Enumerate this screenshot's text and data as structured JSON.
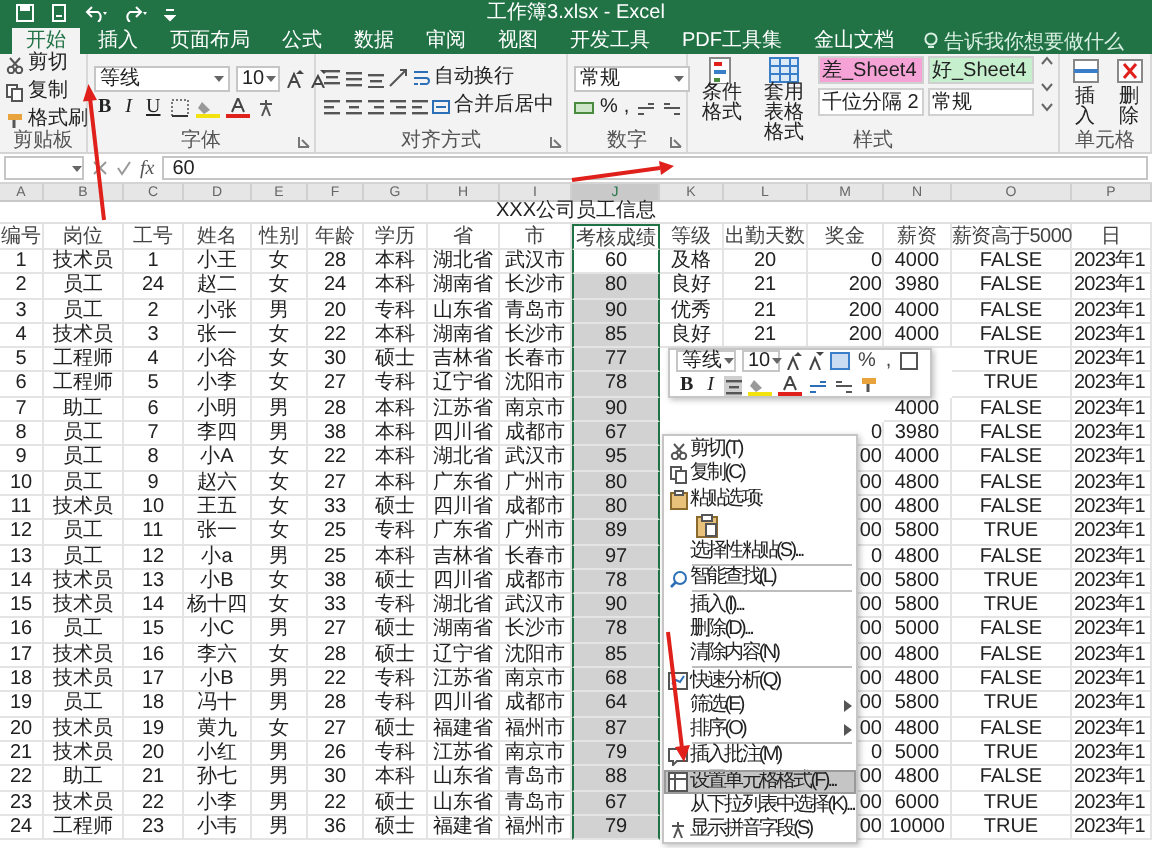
{
  "window": {
    "title": "工作簿3.xlsx - Excel"
  },
  "tabs": [
    {
      "label": "开始",
      "selected": true
    },
    {
      "label": "插入",
      "selected": false
    },
    {
      "label": "页面布局",
      "selected": false
    },
    {
      "label": "公式",
      "selected": false
    },
    {
      "label": "数据",
      "selected": false
    },
    {
      "label": "审阅",
      "selected": false
    },
    {
      "label": "视图",
      "selected": false
    },
    {
      "label": "开发工具",
      "selected": false
    },
    {
      "label": "PDF工具集",
      "selected": false
    },
    {
      "label": "金山文档",
      "selected": false
    }
  ],
  "search": {
    "placeholder": "告诉我你想要做什么"
  },
  "ribbon": [
    {
      "kind": "clipboard",
      "label": "剪贴板",
      "launcher": false,
      "items": [
        "剪切",
        "复制",
        "格式刷"
      ]
    },
    {
      "kind": "font",
      "label": "字体",
      "launcher": true,
      "font": "等线",
      "size": "10",
      "style_buttons": [
        "B",
        "I",
        "U"
      ]
    },
    {
      "kind": "align",
      "label": "对齐方式",
      "launcher": true,
      "items": [
        "自动换行",
        "合并后居中"
      ]
    },
    {
      "kind": "number",
      "label": "数字",
      "launcher": true,
      "format": "常规",
      "symbols": [
        "%",
        ","
      ]
    },
    {
      "kind": "styles",
      "label": "样式",
      "launcher": false,
      "items": [
        "条件格式",
        "套用表格格式"
      ],
      "cell_styles": [
        {
          "text": "差_Sheet4",
          "color": "#f5a3d6"
        },
        {
          "text": "好_Sheet4",
          "color": "#c6efce"
        },
        {
          "text": "千位分隔 2",
          "color": "#ffffff"
        },
        {
          "text": "常规",
          "color": "#ffffff"
        }
      ]
    },
    {
      "kind": "cells",
      "label": "单元格",
      "launcher": false,
      "items": [
        "插入",
        "删除"
      ]
    }
  ],
  "formula_bar": {
    "fx": "fx",
    "value": "60"
  },
  "sheet": {
    "title": "XXX公司员工信息",
    "columns": [
      {
        "letter": "A",
        "label": "编号",
        "selected": false
      },
      {
        "letter": "B",
        "label": "岗位",
        "selected": false
      },
      {
        "letter": "C",
        "label": "工号",
        "selected": false
      },
      {
        "letter": "D",
        "label": "姓名",
        "selected": false
      },
      {
        "letter": "E",
        "label": "性别",
        "selected": false
      },
      {
        "letter": "F",
        "label": "年龄",
        "selected": false
      },
      {
        "letter": "G",
        "label": "学历",
        "selected": false
      },
      {
        "letter": "H",
        "label": "省",
        "selected": false
      },
      {
        "letter": "I",
        "label": "市",
        "selected": false
      },
      {
        "letter": "J",
        "label": "考核成绩",
        "selected": true
      },
      {
        "letter": "K",
        "label": "等级",
        "selected": false
      },
      {
        "letter": "L",
        "label": "出勤天数",
        "selected": false
      },
      {
        "letter": "M",
        "label": "奖金",
        "selected": false
      },
      {
        "letter": "N",
        "label": "薪资",
        "selected": false
      },
      {
        "letter": "O",
        "label": "薪资高于5000",
        "selected": false
      },
      {
        "letter": "P",
        "label": "日",
        "selected": false
      }
    ],
    "rows": [
      {
        "no": "1",
        "post": "技术员",
        "id": "1",
        "name": "小王",
        "sex": "女",
        "age": "28",
        "edu": "本科",
        "province": "湖北省",
        "city": "武汉市",
        "score": "60",
        "grade": "及格",
        "days": "20",
        "bonus": "0",
        "salary": "4000",
        "above": "FALSE",
        "date": "2023年1"
      },
      {
        "no": "2",
        "post": "员工",
        "id": "24",
        "name": "赵二",
        "sex": "女",
        "age": "24",
        "edu": "本科",
        "province": "湖南省",
        "city": "长沙市",
        "score": "80",
        "grade": "良好",
        "days": "21",
        "bonus": "200",
        "salary": "3980",
        "above": "FALSE",
        "date": "2023年1"
      },
      {
        "no": "3",
        "post": "员工",
        "id": "2",
        "name": "小张",
        "sex": "男",
        "age": "20",
        "edu": "专科",
        "province": "山东省",
        "city": "青岛市",
        "score": "90",
        "grade": "优秀",
        "days": "21",
        "bonus": "200",
        "salary": "4000",
        "above": "FALSE",
        "date": "2023年1"
      },
      {
        "no": "4",
        "post": "技术员",
        "id": "3",
        "name": "张一",
        "sex": "女",
        "age": "22",
        "edu": "本科",
        "province": "湖南省",
        "city": "长沙市",
        "score": "85",
        "grade": "良好",
        "days": "21",
        "bonus": "200",
        "salary": "4000",
        "above": "FALSE",
        "date": "2023年1"
      },
      {
        "no": "5",
        "post": "工程师",
        "id": "4",
        "name": "小谷",
        "sex": "女",
        "age": "30",
        "edu": "硕士",
        "province": "吉林省",
        "city": "长春市",
        "score": "77",
        "above": "TRUE",
        "date": "2023年1"
      },
      {
        "no": "6",
        "post": "工程师",
        "id": "5",
        "name": "小李",
        "sex": "女",
        "age": "27",
        "edu": "专科",
        "province": "辽宁省",
        "city": "沈阳市",
        "score": "78",
        "above": "TRUE",
        "date": "2023年1"
      },
      {
        "no": "7",
        "post": "助工",
        "id": "6",
        "name": "小明",
        "sex": "男",
        "age": "28",
        "edu": "本科",
        "province": "江苏省",
        "city": "南京市",
        "score": "90",
        "salary": "4000",
        "above": "FALSE",
        "date": "2023年1"
      },
      {
        "no": "8",
        "post": "员工",
        "id": "7",
        "name": "李四",
        "sex": "男",
        "age": "38",
        "edu": "本科",
        "province": "四川省",
        "city": "成都市",
        "score": "67",
        "bonus": "0",
        "salary": "3980",
        "above": "FALSE",
        "date": "2023年1"
      },
      {
        "no": "9",
        "post": "员工",
        "id": "8",
        "name": "小A",
        "sex": "女",
        "age": "22",
        "edu": "本科",
        "province": "湖北省",
        "city": "武汉市",
        "score": "95",
        "bonus": "00",
        "salary": "4000",
        "above": "FALSE",
        "date": "2023年1"
      },
      {
        "no": "10",
        "post": "员工",
        "id": "9",
        "name": "赵六",
        "sex": "女",
        "age": "27",
        "edu": "本科",
        "province": "广东省",
        "city": "广州市",
        "score": "80",
        "bonus": "00",
        "salary": "4800",
        "above": "FALSE",
        "date": "2023年1"
      },
      {
        "no": "11",
        "post": "技术员",
        "id": "10",
        "name": "王五",
        "sex": "女",
        "age": "33",
        "edu": "硕士",
        "province": "四川省",
        "city": "成都市",
        "score": "80",
        "bonus": "00",
        "salary": "4800",
        "above": "FALSE",
        "date": "2023年1"
      },
      {
        "no": "12",
        "post": "员工",
        "id": "11",
        "name": "张一",
        "sex": "女",
        "age": "25",
        "edu": "专科",
        "province": "广东省",
        "city": "广州市",
        "score": "89",
        "bonus": "00",
        "salary": "5800",
        "above": "TRUE",
        "date": "2023年1"
      },
      {
        "no": "13",
        "post": "员工",
        "id": "12",
        "name": "小a",
        "sex": "男",
        "age": "25",
        "edu": "本科",
        "province": "吉林省",
        "city": "长春市",
        "score": "97",
        "bonus": "0",
        "salary": "4800",
        "above": "FALSE",
        "date": "2023年1"
      },
      {
        "no": "14",
        "post": "技术员",
        "id": "13",
        "name": "小B",
        "sex": "女",
        "age": "38",
        "edu": "硕士",
        "province": "四川省",
        "city": "成都市",
        "score": "78",
        "bonus": "00",
        "salary": "5800",
        "above": "TRUE",
        "date": "2023年1"
      },
      {
        "no": "15",
        "post": "技术员",
        "id": "14",
        "name": "杨十四",
        "sex": "女",
        "age": "33",
        "edu": "专科",
        "province": "湖北省",
        "city": "武汉市",
        "score": "90",
        "bonus": "00",
        "salary": "5800",
        "above": "TRUE",
        "date": "2023年1"
      },
      {
        "no": "16",
        "post": "员工",
        "id": "15",
        "name": "小C",
        "sex": "男",
        "age": "27",
        "edu": "硕士",
        "province": "湖南省",
        "city": "长沙市",
        "score": "78",
        "bonus": "00",
        "salary": "5000",
        "above": "FALSE",
        "date": "2023年1"
      },
      {
        "no": "17",
        "post": "技术员",
        "id": "16",
        "name": "李六",
        "sex": "女",
        "age": "28",
        "edu": "硕士",
        "province": "辽宁省",
        "city": "沈阳市",
        "score": "85",
        "bonus": "00",
        "salary": "4800",
        "above": "FALSE",
        "date": "2023年1"
      },
      {
        "no": "18",
        "post": "技术员",
        "id": "17",
        "name": "小B",
        "sex": "男",
        "age": "22",
        "edu": "专科",
        "province": "江苏省",
        "city": "南京市",
        "score": "68",
        "bonus": "00",
        "salary": "4800",
        "above": "FALSE",
        "date": "2023年1"
      },
      {
        "no": "19",
        "post": "员工",
        "id": "18",
        "name": "冯十",
        "sex": "男",
        "age": "28",
        "edu": "专科",
        "province": "四川省",
        "city": "成都市",
        "score": "64",
        "bonus": "00",
        "salary": "5800",
        "above": "TRUE",
        "date": "2023年1"
      },
      {
        "no": "20",
        "post": "技术员",
        "id": "19",
        "name": "黄九",
        "sex": "女",
        "age": "27",
        "edu": "硕士",
        "province": "福建省",
        "city": "福州市",
        "score": "87",
        "bonus": "00",
        "salary": "4800",
        "above": "FALSE",
        "date": "2023年1"
      },
      {
        "no": "21",
        "post": "技术员",
        "id": "20",
        "name": "小红",
        "sex": "男",
        "age": "26",
        "edu": "专科",
        "province": "江苏省",
        "city": "南京市",
        "score": "79",
        "bonus": "0",
        "salary": "5000",
        "above": "TRUE",
        "date": "2023年1"
      },
      {
        "no": "22",
        "post": "助工",
        "id": "21",
        "name": "孙七",
        "sex": "男",
        "age": "30",
        "edu": "本科",
        "province": "山东省",
        "city": "青岛市",
        "score": "88",
        "bonus": "00",
        "salary": "4800",
        "above": "FALSE",
        "date": "2023年1"
      },
      {
        "no": "23",
        "post": "技术员",
        "id": "22",
        "name": "小李",
        "sex": "男",
        "age": "22",
        "edu": "硕士",
        "province": "山东省",
        "city": "青岛市",
        "score": "67",
        "bonus": "00",
        "salary": "6000",
        "above": "TRUE",
        "date": "2023年1"
      },
      {
        "no": "24",
        "post": "工程师",
        "id": "23",
        "name": "小韦",
        "sex": "男",
        "age": "36",
        "edu": "硕士",
        "province": "福建省",
        "city": "福州市",
        "score": "79",
        "bonus": "00",
        "salary": "10000",
        "above": "TRUE",
        "date": "2023年1"
      }
    ]
  },
  "mini_toolbar": {
    "font": "等线",
    "size": "10",
    "symbols": [
      "%",
      ","
    ],
    "style_buttons": [
      "B",
      "I"
    ]
  },
  "context_menu": [
    {
      "kind": "item",
      "label": "剪切(T)",
      "divider_above": false,
      "submenu": false,
      "selected": false
    },
    {
      "kind": "item",
      "label": "复制(C)",
      "divider_above": false,
      "submenu": false,
      "selected": false
    },
    {
      "kind": "item",
      "label": "粘贴选项:",
      "divider_above": false,
      "submenu": false,
      "selected": false
    },
    {
      "kind": "paste_row",
      "selected": false
    },
    {
      "kind": "item",
      "label": "选择性粘贴(S)...",
      "divider_above": false,
      "submenu": false,
      "selected": false
    },
    {
      "kind": "item",
      "label": "智能查找(L)",
      "divider_above": true,
      "submenu": false,
      "selected": false
    },
    {
      "kind": "item",
      "label": "插入(I)...",
      "divider_above": true,
      "submenu": false,
      "selected": false
    },
    {
      "kind": "item",
      "label": "删除(D)...",
      "divider_above": false,
      "submenu": false,
      "selected": false
    },
    {
      "kind": "item",
      "label": "清除内容(N)",
      "divider_above": false,
      "submenu": false,
      "selected": false
    },
    {
      "kind": "item",
      "label": "快速分析(Q)",
      "divider_above": true,
      "submenu": false,
      "selected": false
    },
    {
      "kind": "item",
      "label": "筛选(E)",
      "divider_above": false,
      "submenu": true,
      "selected": false
    },
    {
      "kind": "item",
      "label": "排序(O)",
      "divider_above": false,
      "submenu": true,
      "selected": false
    },
    {
      "kind": "item",
      "label": "插入批注(M)",
      "divider_above": true,
      "submenu": false,
      "selected": false
    },
    {
      "kind": "item",
      "label": "设置单元格格式(F)...",
      "divider_above": false,
      "submenu": false,
      "selected": true
    },
    {
      "kind": "item",
      "label": "从下拉列表中选择(K)...",
      "divider_above": false,
      "submenu": false,
      "selected": false
    },
    {
      "kind": "item",
      "label": "显示拼音字段(S)",
      "divider_above": false,
      "submenu": false,
      "selected": false
    }
  ]
}
